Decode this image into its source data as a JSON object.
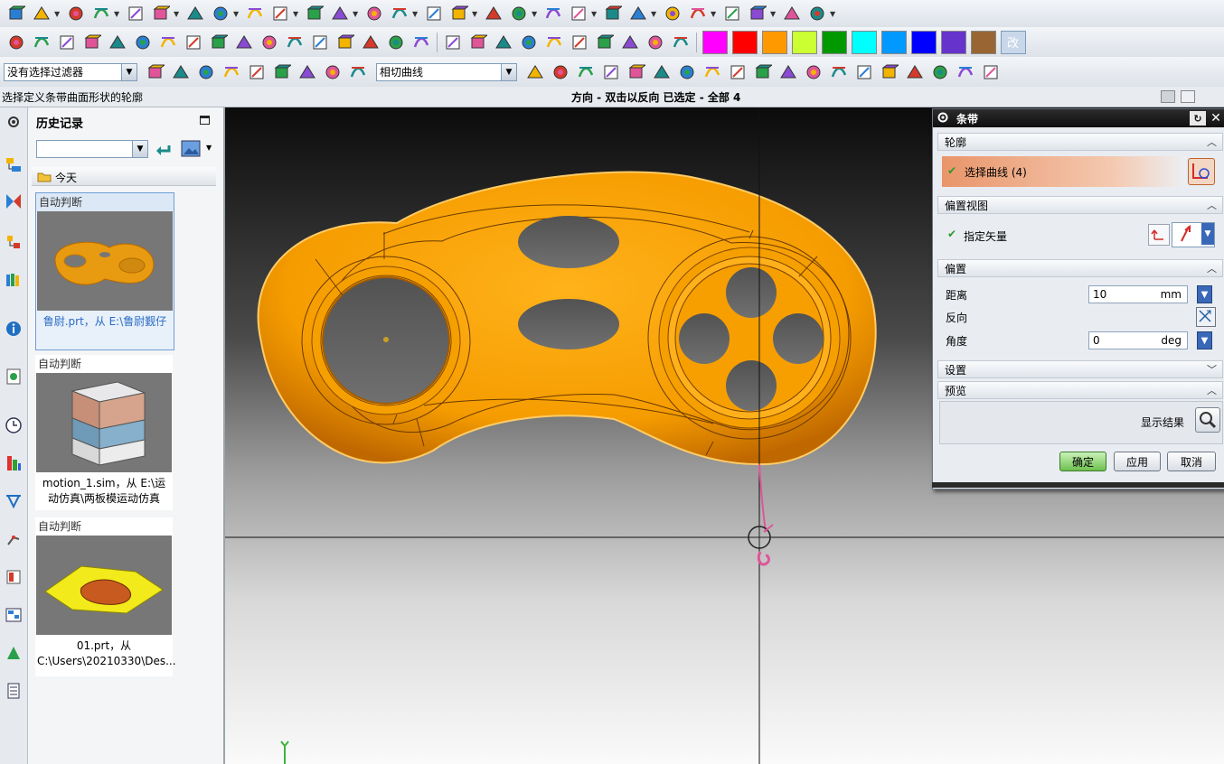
{
  "status": {
    "prompt": "选择定义条带曲面形状的轮廓",
    "message": "方向 - 双击以反向 已选定 - 全部 4"
  },
  "filters": {
    "selection_filter": "没有选择过滤器",
    "curve_rule": "相切曲线"
  },
  "toolbar_icons": {
    "row1": [
      "part-icon",
      "box-icon",
      "stack-icon",
      "pattern-icon",
      "hole-icon",
      "boolean-icon",
      "feature-icon",
      "cylinder-icon",
      "sketch-rect-icon",
      "sheet-icon",
      "sew-icon",
      "surface-icon",
      "mold-icon",
      "block-icon",
      "cavity-icon",
      "core-icon",
      "trim-icon",
      "region-icon",
      "parting-icon",
      "patch-icon",
      "offset-icon",
      "select-icon",
      "curve-icon",
      "text-icon",
      "bridge-icon",
      "spline-icon",
      "cylinder2-icon",
      "move-icon"
    ],
    "row2": [
      "text-char-icon",
      "pattern2-icon",
      "block2-icon",
      "cube-icon",
      "grid-icon",
      "broom-icon",
      "solid-icon",
      "frame-icon",
      "tube-icon",
      "flag-icon",
      "cone-icon",
      "mirror-icon",
      "shell-icon",
      "axis-icon",
      "angle-icon",
      "f8-icon",
      "xlines-icon"
    ],
    "row3": [
      "point-icon",
      "vector-icon",
      "plane-icon",
      "csys-icon",
      "origin-icon",
      "import-icon",
      "snap-icon",
      "paint-icon",
      "rect-select-icon",
      "line-tool-icon",
      "tangent-icon",
      "stamp-icon",
      "transform-icon",
      "forward-icon",
      "move-handle-icon",
      "line-a-icon",
      "line-b-icon",
      "arc-icon",
      "spline2-icon",
      "cross-icon",
      "circle-icon",
      "circle2-icon",
      "plus-icon",
      "slash-icon",
      "shape-icon",
      "xtrim-icon",
      "grid2-icon",
      "mesh-icon"
    ]
  },
  "colors": {
    "palette": [
      "#ff00ff",
      "#ff0000",
      "#ff9900",
      "#ccff33",
      "#009900",
      "#00ffff",
      "#0099ff",
      "#0000ff",
      "#6633cc",
      "#996633"
    ],
    "accent": "#ffa500"
  },
  "color_change_label": "改",
  "history": {
    "title": "历史记录",
    "today": "今天",
    "items": [
      {
        "header": "自动判断",
        "caption": "鲁尉.prt，从 E:\\鲁尉觐仔"
      },
      {
        "header": "自动判断",
        "caption": "motion_1.sim，从 E:\\运动仿真\\两板模运动仿真"
      },
      {
        "header": "自动判断",
        "caption": "01.prt，从 C:\\Users\\20210330\\Des..."
      }
    ]
  },
  "dialog": {
    "title": "条带",
    "section_profile": "轮廓",
    "select_curves": "选择曲线 (4)",
    "section_offset_view": "偏置视图",
    "specify_vector": "指定矢量",
    "section_offset": "偏置",
    "distance_label": "距离",
    "distance_value": "10",
    "distance_unit": "mm",
    "reverse_label": "反向",
    "angle_label": "角度",
    "angle_value": "0",
    "angle_unit": "deg",
    "section_settings": "设置",
    "section_preview": "预览",
    "show_result": "显示结果",
    "ok": "确定",
    "apply": "应用",
    "cancel": "取消"
  }
}
